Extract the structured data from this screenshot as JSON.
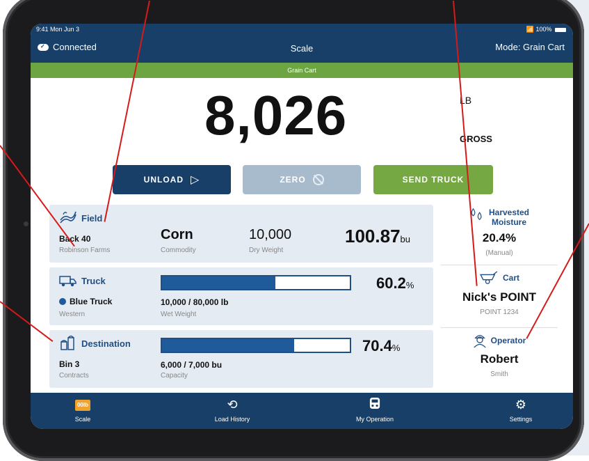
{
  "status_bar": {
    "time": "9:41  Mon Jun 3",
    "signal": "📶",
    "battery_pct": "100%"
  },
  "header": {
    "connection": "Connected",
    "title": "Scale",
    "mode": "Mode: Grain Cart"
  },
  "banner": "Grain Cart",
  "weight": {
    "value": "8,026",
    "unit": "LB",
    "type": "GROSS"
  },
  "actions": {
    "unload": "UNLOAD",
    "zero": "ZERO",
    "send_truck": "SEND TRUCK"
  },
  "field": {
    "title": "Field",
    "name": "Back 40",
    "farm": "Robinson Farms",
    "commodity_value": "Corn",
    "commodity_label": "Commodity",
    "dry_weight_value": "10,000",
    "dry_weight_label": "Dry Weight",
    "yield_value": "100.87",
    "yield_unit": "bu"
  },
  "truck": {
    "title": "Truck",
    "name": "Blue Truck",
    "sub": "Western",
    "load_text": "10,000 / 80,000 lb",
    "load_label": "Wet Weight",
    "fill_pct": 0.602,
    "pct_value": "60.2",
    "pct_unit": "%"
  },
  "destination": {
    "title": "Destination",
    "name": "Bin 3",
    "sub": "Contracts",
    "load_text": "6,000 / 7,000 bu",
    "load_label": "Capacity",
    "fill_pct": 0.704,
    "pct_value": "70.4",
    "pct_unit": "%"
  },
  "moisture": {
    "title_line1": "Harvested",
    "title_line2": "Moisture",
    "value": "20.4%",
    "sub": "(Manual)"
  },
  "cart": {
    "title": "Cart",
    "value": "Nick's POINT",
    "sub": "POINT 1234"
  },
  "operator": {
    "title": "Operator",
    "first": "Robert",
    "last": "Smith"
  },
  "tabs": {
    "scale_badge": "00lb",
    "scale": "Scale",
    "history": "Load History",
    "operation": "My Operation",
    "settings": "Settings"
  },
  "colors": {
    "navy": "#173f67",
    "green": "#6da542",
    "accent_blue": "#1f5a9a",
    "annotation_red": "#d61a1a",
    "badge_orange": "#f0a22c"
  },
  "icons": [
    "cloud-check-icon",
    "play-triangle-icon",
    "no-zero-icon",
    "field-icon",
    "truck-icon",
    "destination-bin-icon",
    "water-drops-icon",
    "cart-icon",
    "operator-icon",
    "history-icon",
    "operation-icon",
    "gear-icon"
  ]
}
